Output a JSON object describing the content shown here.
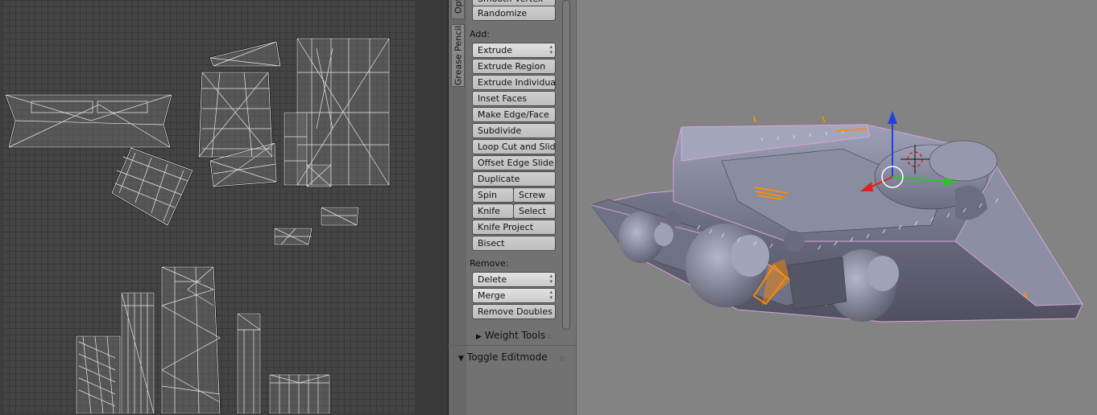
{
  "tool_shelf": {
    "tabs": [
      "Opt",
      "Grease Pencil"
    ],
    "cut_top_label": "Smooth Vertex",
    "randomize": "Randomize",
    "add": {
      "label": "Add:",
      "extrude": "Extrude",
      "extrude_region": "Extrude Region",
      "extrude_individual": "Extrude Individual",
      "inset_faces": "Inset Faces",
      "make_edge_face": "Make Edge/Face",
      "subdivide": "Subdivide",
      "loop_cut_slide": "Loop Cut and Slide",
      "offset_edge_slide": "Offset Edge Slide",
      "duplicate": "Duplicate",
      "spin": "Spin",
      "screw": "Screw",
      "knife": "Knife",
      "select": "Select",
      "knife_project": "Knife Project",
      "bisect": "Bisect"
    },
    "remove": {
      "label": "Remove:",
      "delete": "Delete",
      "merge": "Merge",
      "remove_doubles": "Remove Doubles"
    },
    "weight_tools": "Weight Tools",
    "toggle_editmode": "Toggle Editmode",
    "drag_grip": "::::"
  },
  "colors": {
    "uv_background": "#444444",
    "panel": "#727272",
    "viewport": "#838383",
    "selection_orange": "#ff8c00",
    "mesh_gray": "#7a7c92",
    "wire_pink": "#d7a2d9",
    "axis_x": "#e02020",
    "axis_y": "#30c030",
    "axis_z": "#2040e0"
  },
  "icons": [
    "triangle-right-icon",
    "triangle-down-icon",
    "dropdown-arrows-icon",
    "drag-grip-icon",
    "transform-manipulator-icon",
    "3d-cursor-icon"
  ]
}
